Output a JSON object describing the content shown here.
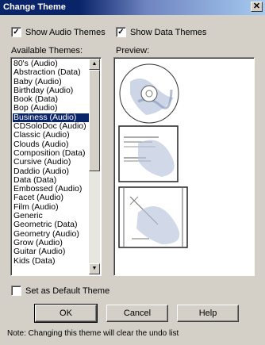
{
  "window": {
    "title": "Change Theme",
    "close_label": "✕"
  },
  "options": {
    "show_audio": {
      "label": "Show Audio Themes",
      "checked": true,
      "mark": "✓"
    },
    "show_data": {
      "label": "Show Data Themes",
      "checked": true,
      "mark": "✓"
    },
    "set_default": {
      "label": "Set as Default Theme",
      "checked": false,
      "mark": ""
    }
  },
  "available_label": "Available Themes:",
  "preview_label": "Preview:",
  "themes": [
    "80's (Audio)",
    "Abstraction (Data)",
    "Baby (Audio)",
    "Birthday (Audio)",
    "Book (Data)",
    "Bop (Audio)",
    "Business (Audio)",
    "CDSoloDoc (Audio)",
    "Classic (Audio)",
    "Clouds (Audio)",
    "Composition (Data)",
    "Cursive (Audio)",
    "Daddio (Audio)",
    "Data (Data)",
    "Embossed (Audio)",
    "Facet (Audio)",
    "Film (Audio)",
    "Generic",
    "Geometric (Data)",
    "Geometry (Audio)",
    "Grow (Audio)",
    "Guitar (Audio)",
    "Kids (Data)"
  ],
  "selected_index": 6,
  "buttons": {
    "ok": "OK",
    "cancel": "Cancel",
    "help": "Help"
  },
  "note": "Note: Changing this theme will clear the undo list"
}
